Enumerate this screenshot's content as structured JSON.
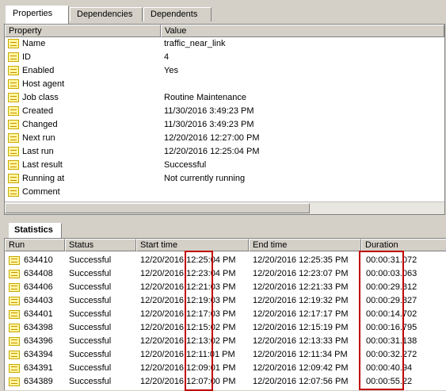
{
  "tabs": [
    {
      "label": "Properties",
      "active": true
    },
    {
      "label": "Dependencies",
      "active": false
    },
    {
      "label": "Dependents",
      "active": false
    }
  ],
  "properties": {
    "columns": [
      "Property",
      "Value"
    ],
    "rows": [
      {
        "name": "Name",
        "value": "traffic_near_link"
      },
      {
        "name": "ID",
        "value": "4"
      },
      {
        "name": "Enabled",
        "value": "Yes"
      },
      {
        "name": "Host agent",
        "value": ""
      },
      {
        "name": "Job class",
        "value": "Routine Maintenance"
      },
      {
        "name": "Created",
        "value": "11/30/2016 3:49:23 PM"
      },
      {
        "name": "Changed",
        "value": "11/30/2016 3:49:23 PM"
      },
      {
        "name": "Next run",
        "value": "12/20/2016 12:27:00 PM"
      },
      {
        "name": "Last run",
        "value": "12/20/2016 12:25:04 PM"
      },
      {
        "name": "Last result",
        "value": "Successful"
      },
      {
        "name": "Running at",
        "value": "Not currently running"
      },
      {
        "name": "Comment",
        "value": ""
      }
    ]
  },
  "statistics": {
    "tab_label": "Statistics",
    "columns": [
      "Run",
      "Status",
      "Start time",
      "End time",
      "Duration"
    ],
    "rows": [
      {
        "run": "634410",
        "status": "Successful",
        "start": "12/20/2016 12:25:04 PM",
        "end": "12/20/2016 12:25:35 PM",
        "duration": "00:00:31.072"
      },
      {
        "run": "634408",
        "status": "Successful",
        "start": "12/20/2016 12:23:04 PM",
        "end": "12/20/2016 12:23:07 PM",
        "duration": "00:00:03.063"
      },
      {
        "run": "634406",
        "status": "Successful",
        "start": "12/20/2016 12:21:03 PM",
        "end": "12/20/2016 12:21:33 PM",
        "duration": "00:00:29.812"
      },
      {
        "run": "634403",
        "status": "Successful",
        "start": "12/20/2016 12:19:03 PM",
        "end": "12/20/2016 12:19:32 PM",
        "duration": "00:00:29.327"
      },
      {
        "run": "634401",
        "status": "Successful",
        "start": "12/20/2016 12:17:03 PM",
        "end": "12/20/2016 12:17:17 PM",
        "duration": "00:00:14.702"
      },
      {
        "run": "634398",
        "status": "Successful",
        "start": "12/20/2016 12:15:02 PM",
        "end": "12/20/2016 12:15:19 PM",
        "duration": "00:00:16.795"
      },
      {
        "run": "634396",
        "status": "Successful",
        "start": "12/20/2016 12:13:02 PM",
        "end": "12/20/2016 12:13:33 PM",
        "duration": "00:00:31.138"
      },
      {
        "run": "634394",
        "status": "Successful",
        "start": "12/20/2016 12:11:01 PM",
        "end": "12/20/2016 12:11:34 PM",
        "duration": "00:00:32.272"
      },
      {
        "run": "634391",
        "status": "Successful",
        "start": "12/20/2016 12:09:01 PM",
        "end": "12/20/2016 12:09:42 PM",
        "duration": "00:00:40.94"
      },
      {
        "run": "634389",
        "status": "Successful",
        "start": "12/20/2016 12:07:00 PM",
        "end": "12/20/2016 12:07:56 PM",
        "duration": "00:00:55.22"
      }
    ]
  },
  "highlight_color": "#c00000"
}
